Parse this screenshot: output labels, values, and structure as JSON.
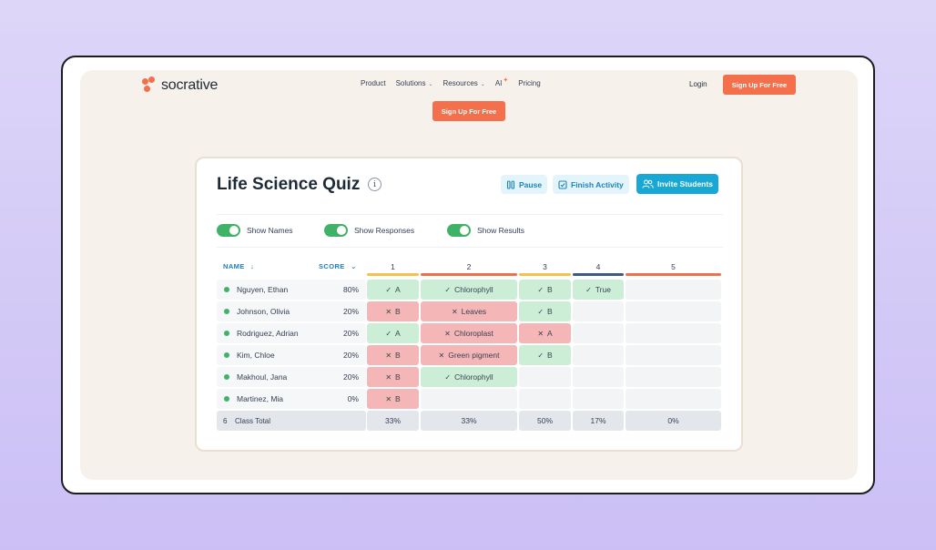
{
  "brand": {
    "name": "socrative"
  },
  "nav": {
    "items": [
      {
        "label": "Product",
        "has_chevron": false
      },
      {
        "label": "Solutions",
        "has_chevron": true
      },
      {
        "label": "Resources",
        "has_chevron": true
      },
      {
        "label": "AI",
        "has_chevron": false
      },
      {
        "label": "Pricing",
        "has_chevron": false
      }
    ],
    "login": "Login",
    "cta": "Sign Up For Free",
    "cta_secondary": "Sign Up For Free"
  },
  "colors": {
    "accent_orange": "#f4704c",
    "accent_blue": "#19a7d6",
    "correct": "#cdeed6",
    "wrong": "#f4b6b6",
    "toggle_on": "#3fb268"
  },
  "quiz": {
    "title": "Life Science Quiz",
    "info_icon": "i",
    "actions": {
      "pause": "Pause",
      "finish": "Finish Activity",
      "invite": "Invite Students"
    },
    "toggles": [
      {
        "label": "Show Names",
        "on": true
      },
      {
        "label": "Show Responses",
        "on": true
      },
      {
        "label": "Show Results",
        "on": true
      }
    ],
    "headers": {
      "name": "NAME",
      "score": "SCORE"
    },
    "questions": [
      {
        "label": "1",
        "color": "#f2c14e"
      },
      {
        "label": "2",
        "color": "#e8734f"
      },
      {
        "label": "3",
        "color": "#f2c14e"
      },
      {
        "label": "4",
        "color": "#3d5a80"
      },
      {
        "label": "5",
        "color": "#e8734f"
      }
    ],
    "students": [
      {
        "name": "Nguyen, Ethan",
        "score": "80%",
        "answers": [
          {
            "text": "A",
            "status": "correct"
          },
          {
            "text": "Chlorophyll",
            "status": "correct"
          },
          {
            "text": "B",
            "status": "correct"
          },
          {
            "text": "True",
            "status": "correct"
          },
          {
            "text": "",
            "status": "empty"
          }
        ]
      },
      {
        "name": "Johnson, Olivia",
        "score": "20%",
        "answers": [
          {
            "text": "B",
            "status": "wrong"
          },
          {
            "text": "Leaves",
            "status": "wrong"
          },
          {
            "text": "B",
            "status": "correct"
          },
          {
            "text": "",
            "status": "empty"
          },
          {
            "text": "",
            "status": "empty"
          }
        ]
      },
      {
        "name": "Rodriguez, Adrian",
        "score": "20%",
        "answers": [
          {
            "text": "A",
            "status": "correct"
          },
          {
            "text": "Chloroplast",
            "status": "wrong"
          },
          {
            "text": "A",
            "status": "wrong"
          },
          {
            "text": "",
            "status": "empty"
          },
          {
            "text": "",
            "status": "empty"
          }
        ]
      },
      {
        "name": "Kim, Chloe",
        "score": "20%",
        "answers": [
          {
            "text": "B",
            "status": "wrong"
          },
          {
            "text": "Green pigment",
            "status": "wrong"
          },
          {
            "text": "B",
            "status": "correct"
          },
          {
            "text": "",
            "status": "empty"
          },
          {
            "text": "",
            "status": "empty"
          }
        ]
      },
      {
        "name": "Makhoul, Jana",
        "score": "20%",
        "answers": [
          {
            "text": "B",
            "status": "wrong"
          },
          {
            "text": "Chlorophyll",
            "status": "correct"
          },
          {
            "text": "",
            "status": "empty"
          },
          {
            "text": "",
            "status": "empty"
          },
          {
            "text": "",
            "status": "empty"
          }
        ]
      },
      {
        "name": "Martinez, Mia",
        "score": "0%",
        "answers": [
          {
            "text": "B",
            "status": "wrong"
          },
          {
            "text": "",
            "status": "empty"
          },
          {
            "text": "",
            "status": "empty"
          },
          {
            "text": "",
            "status": "empty"
          },
          {
            "text": "",
            "status": "empty"
          }
        ]
      }
    ],
    "total": {
      "count": "6",
      "label": "Class Total",
      "values": [
        "33%",
        "33%",
        "50%",
        "17%",
        "0%"
      ]
    }
  }
}
